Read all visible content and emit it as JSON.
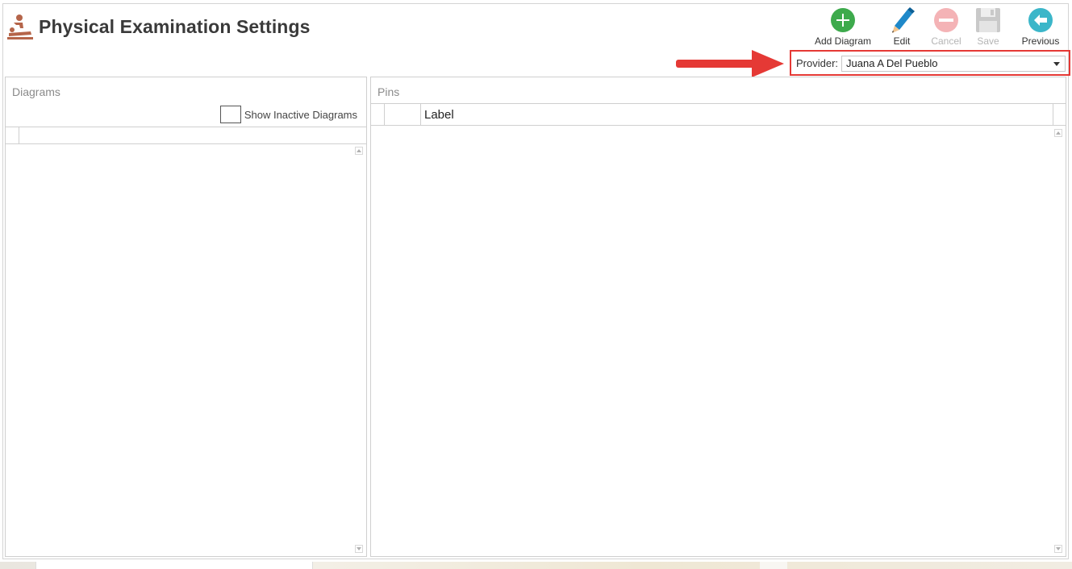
{
  "header": {
    "title": "Physical Examination Settings",
    "title_icon": "massage-therapy-icon"
  },
  "toolbar": {
    "add_diagram": "Add Diagram",
    "edit": "Edit",
    "cancel": "Cancel",
    "save": "Save",
    "previous": "Previous"
  },
  "provider": {
    "label": "Provider:",
    "value": "Juana A Del Pueblo"
  },
  "diagrams": {
    "title": "Diagrams",
    "show_inactive_label": "Show Inactive Diagrams",
    "show_inactive_checked": false
  },
  "pins": {
    "title": "Pins",
    "columns": [
      "",
      "",
      "Label"
    ]
  },
  "colors": {
    "accent_red": "#e53935",
    "add_green": "#3daa4c",
    "edit_blue": "#1e88c9",
    "previous_teal": "#3bb6c9"
  }
}
